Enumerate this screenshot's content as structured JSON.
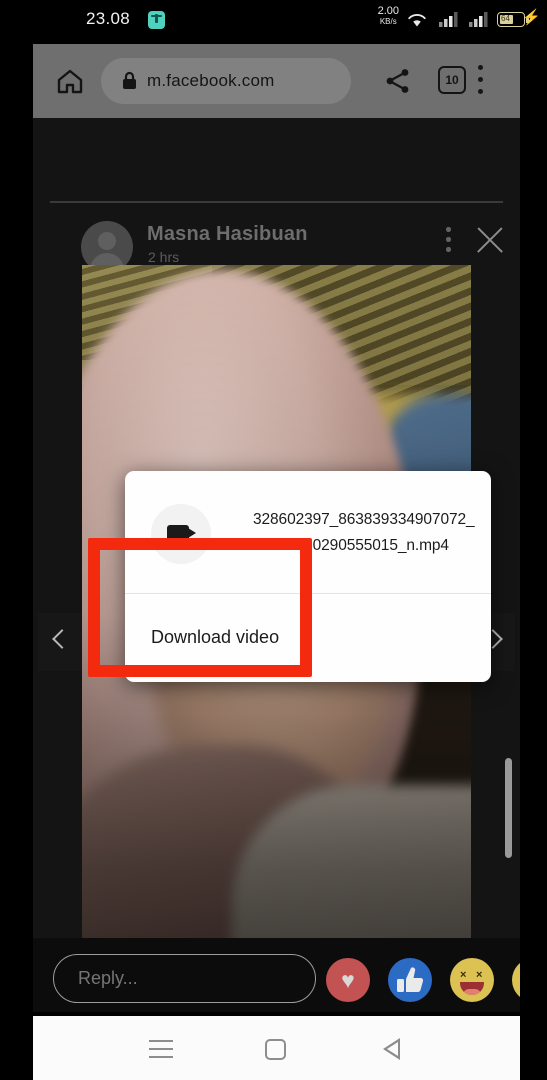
{
  "status_bar": {
    "time": "23.08",
    "app_icon": "clipboard-icon",
    "data_rate_value": "2.00",
    "data_rate_unit": "KB/s",
    "wifi_icon": "wifi-icon",
    "signal_icons": [
      "signal-bars-sim1-icon",
      "signal-bars-sim2-icon"
    ],
    "battery_level": "64",
    "charging_icon": "lightning-bolt-icon"
  },
  "browser": {
    "home_icon": "home-icon",
    "lock_icon": "lock-icon",
    "url": "m.facebook.com",
    "share_icon": "share-icon",
    "tab_count": "10",
    "menu_icon": "three-dot-menu-icon"
  },
  "post": {
    "author": "Masna Hasibuan",
    "timestamp": "2 hrs",
    "avatar_icon": "default-avatar-icon",
    "menu_icon": "three-dot-menu-icon",
    "close_icon": "close-x-icon",
    "prev_icon": "chevron-left-icon",
    "next_icon": "chevron-right-icon"
  },
  "dialog": {
    "file_icon": "video-camera-icon",
    "filename": "328602397_863839334907072_53201250290555015_n.mp4",
    "action_label": "Download video"
  },
  "annotation": {
    "highlight_color": "#f32a0e",
    "target": "Download video"
  },
  "reply_bar": {
    "placeholder": "Reply...",
    "reactions": [
      {
        "name": "heart-reaction",
        "glyph": "♥",
        "color": "#c35353"
      },
      {
        "name": "like-reaction",
        "glyph": "👍",
        "color": "#2c6bc4"
      },
      {
        "name": "haha-reaction",
        "glyph": "",
        "color": "#dcc252"
      },
      {
        "name": "wow-reaction",
        "glyph": "",
        "color": "#dcc252"
      }
    ]
  },
  "nav_bar": {
    "recents_icon": "recents-icon",
    "home_icon": "home-square-icon",
    "back_icon": "back-triangle-icon"
  }
}
